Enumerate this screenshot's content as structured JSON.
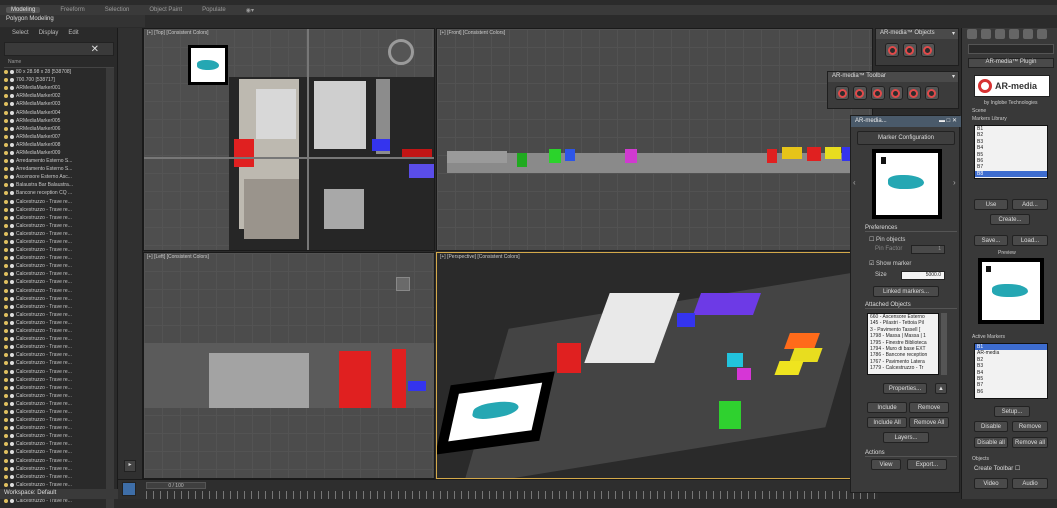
{
  "ribbon": {
    "tabs": [
      "Modeling",
      "Freeform",
      "Selection",
      "Object Paint",
      "Populate"
    ],
    "active_tab": "Modeling",
    "sub_tab": "Polygon Modeling"
  },
  "explorer": {
    "menu": [
      "Select",
      "Display",
      "Edit"
    ],
    "column_header": "Name",
    "rows": [
      "80 x 28.98 x 28 [538708]",
      "700.700 [538717]",
      "ARMediaMarker001",
      "ARMediaMarker002",
      "ARMediaMarker003",
      "ARMediaMarker004",
      "ARMediaMarker005",
      "ARMediaMarker006",
      "ARMediaMarker007",
      "ARMediaMarker008",
      "ARMediaMarker009",
      "Arredamento Esterno S...",
      "Arredamento Esterno S...",
      "Ascensore Esterno Asc...",
      "Balaustra Bar Balaustra...",
      "Bancone reception CQ ...",
      "Calcestruzzo - Trave re...",
      "Calcestruzzo - Trave re...",
      "Calcestruzzo - Trave re...",
      "Calcestruzzo - Trave re...",
      "Calcestruzzo - Trave re...",
      "Calcestruzzo - Trave re...",
      "Calcestruzzo - Trave re...",
      "Calcestruzzo - Trave re...",
      "Calcestruzzo - Trave re...",
      "Calcestruzzo - Trave re...",
      "Calcestruzzo - Trave re...",
      "Calcestruzzo - Trave re...",
      "Calcestruzzo - Trave re...",
      "Calcestruzzo - Trave re...",
      "Calcestruzzo - Trave re...",
      "Calcestruzzo - Trave re...",
      "Calcestruzzo - Trave re...",
      "Calcestruzzo - Trave re...",
      "Calcestruzzo - Trave re...",
      "Calcestruzzo - Trave re...",
      "Calcestruzzo - Trave re...",
      "Calcestruzzo - Trave re...",
      "Calcestruzzo - Trave re...",
      "Calcestruzzo - Trave re...",
      "Calcestruzzo - Trave re...",
      "Calcestruzzo - Trave re...",
      "Calcestruzzo - Trave re...",
      "Calcestruzzo - Trave re...",
      "Calcestruzzo - Trave re...",
      "Calcestruzzo - Trave re...",
      "Calcestruzzo - Trave re...",
      "Calcestruzzo - Trave re...",
      "Calcestruzzo - Trave re...",
      "Calcestruzzo - Trave re...",
      "Calcestruzzo - Trave re...",
      "Calcestruzzo - Trave re...",
      "Calcestruzzo - Trave re...",
      "Calcestruzzo - Trave re..."
    ],
    "workspace": "Workspace: Default"
  },
  "viewports": {
    "top": "[+] [Top] [Consistent Colors]",
    "front": "[+] [Front] [Consistent Colors]",
    "left": "[+] [Left] [Consistent Colors]",
    "perspective": "[+] [Perspective] [Consistent Colors]"
  },
  "timeline": {
    "position": "0 / 100"
  },
  "objects_panel": {
    "title": "AR-media™ Objects"
  },
  "toolbar_panel": {
    "title": "AR-media™ Toolbar"
  },
  "marker_config": {
    "window_title": "AR-media...",
    "header": "Marker Configuration",
    "preferences_label": "Preferences",
    "pin_objects": "Pin objects",
    "pin_factor": "Pin Factor",
    "pin_factor_value": "1",
    "show_marker": "Show marker",
    "size_label": "Size",
    "size_value": "5000.0",
    "linked_markers": "Linked markers...",
    "attached_label": "Attached Objects",
    "attached": [
      "660 - Ascensore Esterno",
      "145 - Pilastri - Tettoia Pil",
      "3 - Pavimento Tassell [",
      "1798 - Massa | Massa | 1",
      "1795 - Finestre Biblioteca",
      "1794 - Muro di base EXT",
      "1786 - Bancone reception",
      "1767 - Pavimento Latera",
      "1779 - Calcestruzzo - Tr"
    ],
    "properties": "Properties...",
    "include": "Include",
    "remove": "Remove",
    "include_all": "Include All",
    "remove_all": "Remove All",
    "layers": "Layers...",
    "actions_label": "Actions",
    "view": "View",
    "export": "Export..."
  },
  "plugin_panel": {
    "title": "AR-media™ Plugin",
    "logo_text": "AR-media",
    "company": "by Inglobe Technologies",
    "scene_label": "Scene",
    "library_label": "Markers Library",
    "library": [
      "B1",
      "B2",
      "B3",
      "B4",
      "B5",
      "B6",
      "B7",
      "B8"
    ],
    "library_selected": 7,
    "use": "Use",
    "add": "Add...",
    "create": "Create...",
    "save": "Save...",
    "load": "Load...",
    "preview_label": "Preview",
    "active_label": "Active Markers",
    "active": [
      "B1",
      "AR-media",
      "B2",
      "B3",
      "B4",
      "B5",
      "B7",
      "B6"
    ],
    "active_selected": 0,
    "setup": "Setup...",
    "disable": "Disable",
    "remove": "Remove",
    "disable_all": "Disable all",
    "remove_all": "Remove all",
    "objects_label": "Objects",
    "create_toolbar": "Create Toolbar",
    "video": "Video",
    "audio": "Audio"
  }
}
